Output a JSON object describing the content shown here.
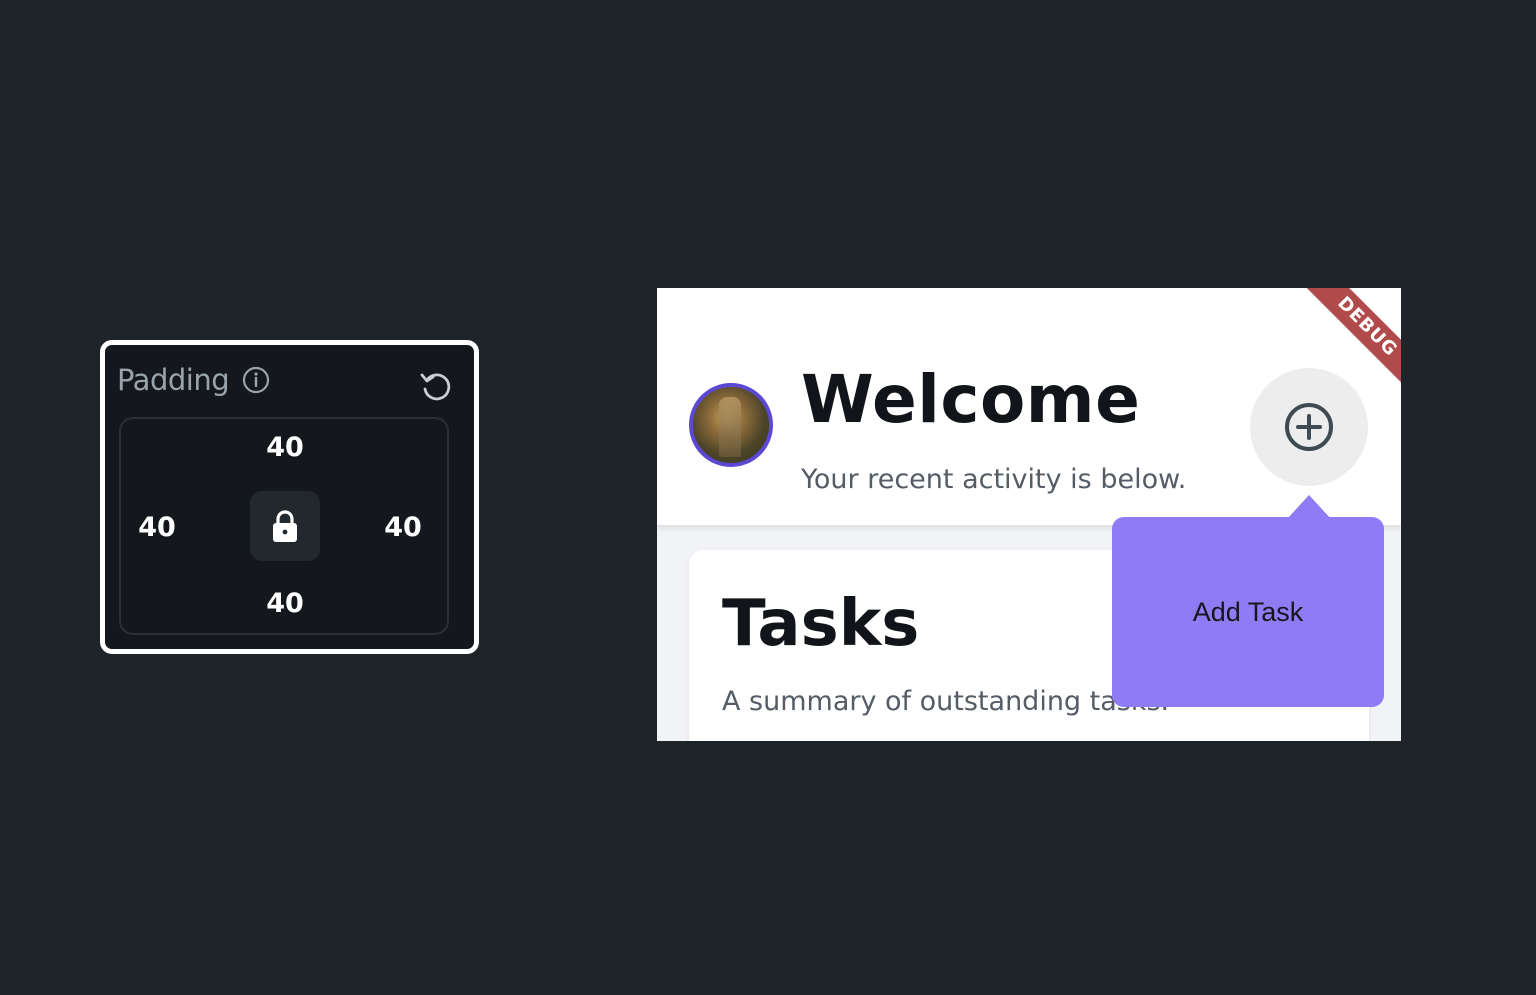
{
  "padding_panel": {
    "title": "Padding",
    "top": "40",
    "left": "40",
    "right": "40",
    "bottom": "40",
    "icons": {
      "info": "info-icon",
      "reset": "reset-icon",
      "lock": "lock-icon"
    }
  },
  "preview": {
    "welcome_title": "Welcome",
    "welcome_subtitle": "Your recent activity is below.",
    "debug_banner": "DEBUG",
    "tasks_title": "Tasks",
    "tasks_subtitle": "A summary of outstanding tasks.",
    "tooltip": "Add Task",
    "icons": {
      "add": "add-circle-icon",
      "avatar": "avatar-image"
    },
    "colors": {
      "accent": "#8f7cf5",
      "avatar_border": "#5b49d6",
      "debug": "#b14a4a"
    }
  }
}
